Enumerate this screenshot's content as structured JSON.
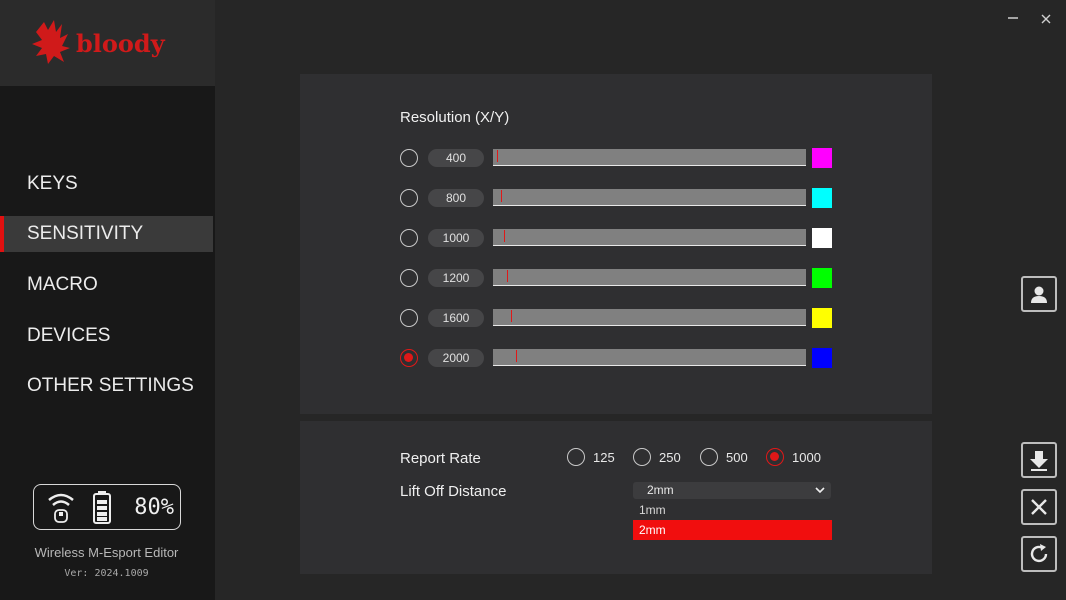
{
  "brand": {
    "logo_text": "bloody"
  },
  "window": {
    "minimize_icon": "minimize-icon",
    "close_icon": "close-icon"
  },
  "nav": {
    "items": [
      {
        "label": "KEYS",
        "active": false
      },
      {
        "label": "SENSITIVITY",
        "active": true
      },
      {
        "label": "MACRO",
        "active": false
      },
      {
        "label": "DEVICES",
        "active": false
      },
      {
        "label": "OTHER SETTINGS",
        "active": false
      }
    ]
  },
  "status": {
    "wifi_icon": "wifi-icon",
    "battery_icon": "battery-icon",
    "battery_percent": "80%"
  },
  "app": {
    "name": "Wireless M-Esport Editor",
    "version": "Ver: 2024.1009"
  },
  "resolution": {
    "title": "Resolution (X/Y)",
    "levels": [
      {
        "dpi": "400",
        "selected": false,
        "color": "#ff00ff",
        "slider_fraction": 0.013
      },
      {
        "dpi": "800",
        "selected": false,
        "color": "#00ffff",
        "slider_fraction": 0.026
      },
      {
        "dpi": "1000",
        "selected": false,
        "color": "#ffffff",
        "slider_fraction": 0.035
      },
      {
        "dpi": "1200",
        "selected": false,
        "color": "#00ff00",
        "slider_fraction": 0.045
      },
      {
        "dpi": "1600",
        "selected": false,
        "color": "#ffff00",
        "slider_fraction": 0.058
      },
      {
        "dpi": "2000",
        "selected": true,
        "color": "#0000ff",
        "slider_fraction": 0.074
      }
    ]
  },
  "report_rate": {
    "label": "Report Rate",
    "options": [
      {
        "value": "125",
        "selected": false
      },
      {
        "value": "250",
        "selected": false
      },
      {
        "value": "500",
        "selected": false
      },
      {
        "value": "1000",
        "selected": true
      }
    ]
  },
  "lift_off": {
    "label": "Lift Off Distance",
    "value": "2mm",
    "options": [
      {
        "value": "1mm",
        "selected": false
      },
      {
        "value": "2mm",
        "selected": true
      }
    ]
  },
  "side_buttons": [
    "user-icon",
    "download-icon",
    "close-icon",
    "refresh-icon"
  ],
  "colors": {
    "accent": "#e01818",
    "selected_option": "#f10e0e"
  }
}
